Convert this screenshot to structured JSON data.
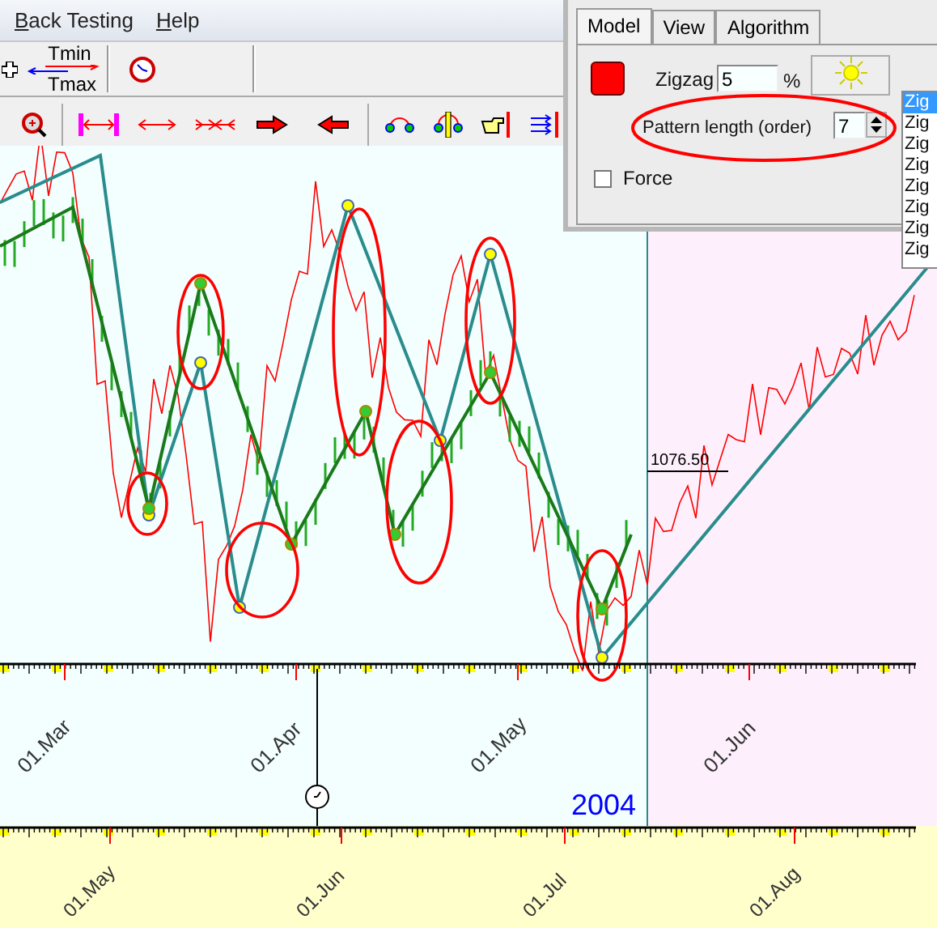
{
  "menu": [
    {
      "label": "Back Testing"
    },
    {
      "label": "Help"
    }
  ],
  "toolbar": {
    "tmin": "Tmin",
    "tmax": "Tmax"
  },
  "dialog": {
    "tabs": [
      {
        "label": "Model",
        "selected": true
      },
      {
        "label": "View",
        "selected": false
      },
      {
        "label": "Algorithm",
        "selected": false
      }
    ],
    "zigzag_label": "Zigzag",
    "zigzag_value": "5",
    "unit": "%",
    "pattern_label": "Pattern length (order)",
    "pattern_value": "7",
    "force": {
      "label": "Force",
      "checked": false
    },
    "list": [
      {
        "label": "Zig",
        "selected": true
      },
      {
        "label": "Zig",
        "selected": false
      },
      {
        "label": "Zig",
        "selected": false
      },
      {
        "label": "Zig",
        "selected": false
      },
      {
        "label": "Zig",
        "selected": false
      },
      {
        "label": "Zig",
        "selected": false
      },
      {
        "label": "Zig",
        "selected": false
      },
      {
        "label": "Zig",
        "selected": false
      }
    ]
  },
  "chart": {
    "price_label": "1076.50",
    "year": "2004",
    "axis_top": [
      "01.Mar",
      "01.Apr",
      "01.May",
      "01.Jun"
    ],
    "axis_bottom": [
      "01.May",
      "01.Jun",
      "01.Jul",
      "01.Aug"
    ]
  }
}
